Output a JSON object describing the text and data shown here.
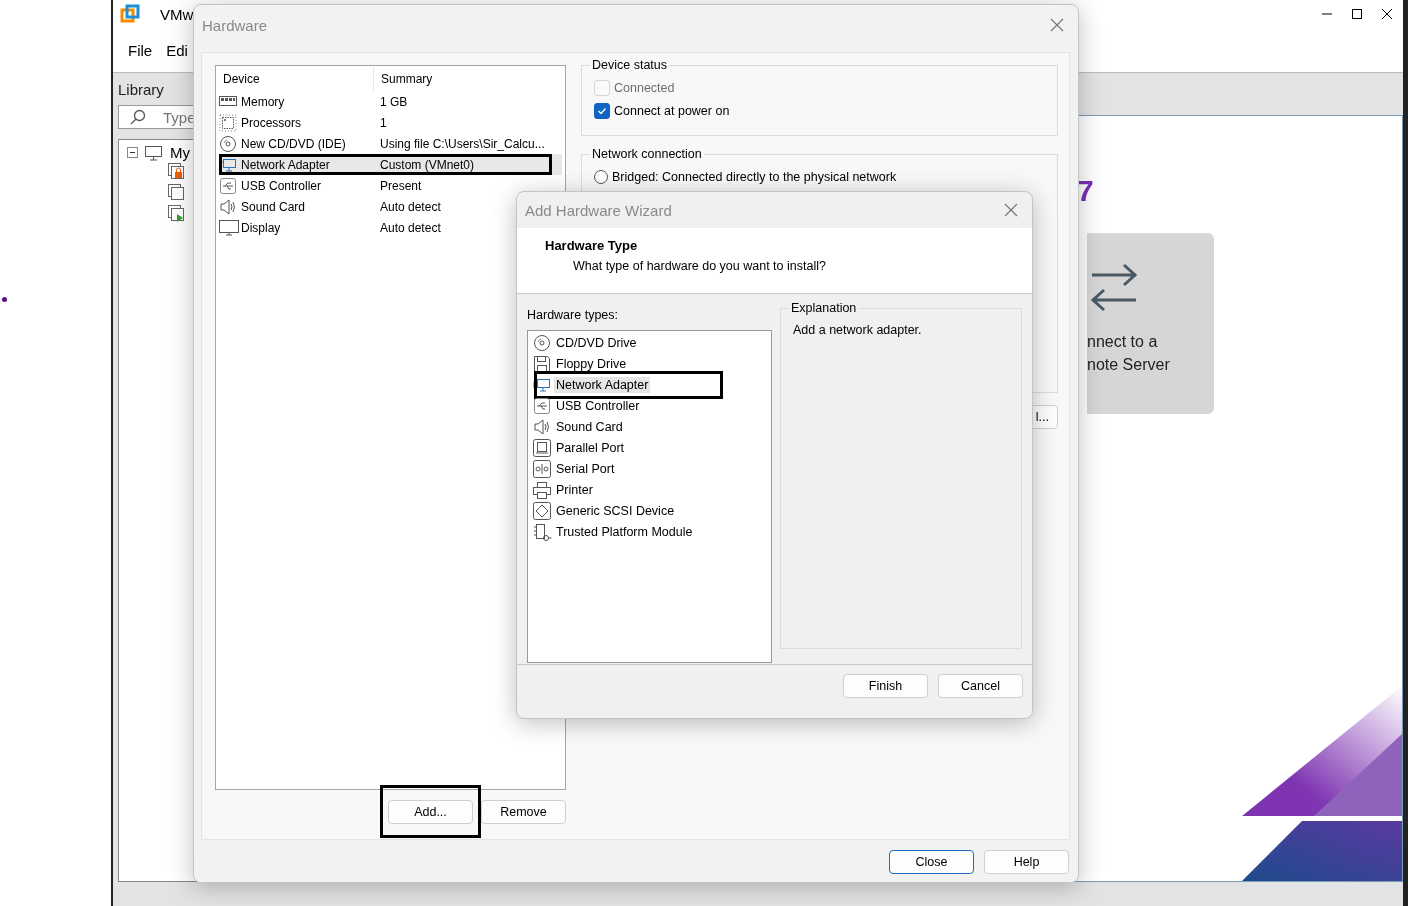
{
  "main_window": {
    "title": "VMw",
    "menu": [
      "File",
      "Edi"
    ],
    "library": {
      "title": "Library",
      "search": {
        "placeholder": "Type"
      },
      "tree": [
        {
          "label": "My",
          "expanded": true,
          "children": [
            {
              "kind": "locked"
            },
            {
              "kind": "plain"
            },
            {
              "kind": "running"
            }
          ]
        }
      ]
    },
    "home": {
      "heading": "7",
      "card_lines": [
        "nnect to a",
        "note Server"
      ]
    }
  },
  "hardware_dialog": {
    "title": "Hardware",
    "columns": [
      "Device",
      "Summary"
    ],
    "devices": [
      {
        "kind": "memory",
        "name": "Memory",
        "summary": "1 GB",
        "selected": false,
        "marked": false
      },
      {
        "kind": "cpu",
        "name": "Processors",
        "summary": "1",
        "selected": false,
        "marked": false
      },
      {
        "kind": "disc",
        "name": "New CD/DVD (IDE)",
        "summary": "Using file C:\\Users\\Sir_Calcu...",
        "selected": false,
        "marked": false
      },
      {
        "kind": "network",
        "name": "Network Adapter",
        "summary": "Custom (VMnet0)",
        "selected": true,
        "marked": true
      },
      {
        "kind": "usb",
        "name": "USB Controller",
        "summary": "Present",
        "selected": false,
        "marked": false
      },
      {
        "kind": "sound",
        "name": "Sound Card",
        "summary": "Auto detect",
        "selected": false,
        "marked": false
      },
      {
        "kind": "display",
        "name": "Display",
        "summary": "Auto detect",
        "selected": false,
        "marked": false
      }
    ],
    "device_status": {
      "title": "Device status",
      "options": [
        {
          "label": "Connected",
          "checked": false,
          "disabled": true
        },
        {
          "label": "Connect at power on",
          "checked": true,
          "disabled": false
        }
      ]
    },
    "network_connection": {
      "title": "Network connection",
      "options": [
        {
          "label": "Bridged: Connected directly to the physical network",
          "selected": false
        }
      ],
      "button": "l..."
    },
    "add_button": {
      "label": "Add...",
      "marked": true
    },
    "remove_button": {
      "label": "Remove"
    },
    "buttons": [
      {
        "label": "Close",
        "default": true
      },
      {
        "label": "Help",
        "default": false
      }
    ]
  },
  "wizard": {
    "title": "Add Hardware Wizard",
    "heading": "Hardware Type",
    "subtitle": "What type of hardware do you want to install?",
    "list_label": "Hardware types:",
    "types": [
      {
        "kind": "disc",
        "label": "CD/DVD Drive",
        "selected": false,
        "marked": false
      },
      {
        "kind": "floppy",
        "label": "Floppy Drive",
        "selected": false,
        "marked": false
      },
      {
        "kind": "network",
        "label": "Network Adapter",
        "selected": true,
        "marked": true
      },
      {
        "kind": "usb",
        "label": "USB Controller",
        "selected": false,
        "marked": false
      },
      {
        "kind": "sound",
        "label": "Sound Card",
        "selected": false,
        "marked": false
      },
      {
        "kind": "parallel",
        "label": "Parallel Port",
        "selected": false,
        "marked": false
      },
      {
        "kind": "serial",
        "label": "Serial Port",
        "selected": false,
        "marked": false
      },
      {
        "kind": "printer",
        "label": "Printer",
        "selected": false,
        "marked": false
      },
      {
        "kind": "scsi",
        "label": "Generic SCSI Device",
        "selected": false,
        "marked": false
      },
      {
        "kind": "tpm",
        "label": "Trusted Platform Module",
        "selected": false,
        "marked": false
      }
    ],
    "explanation": {
      "title": "Explanation",
      "text": "Add a network adapter."
    },
    "buttons": [
      "Finish",
      "Cancel"
    ]
  }
}
